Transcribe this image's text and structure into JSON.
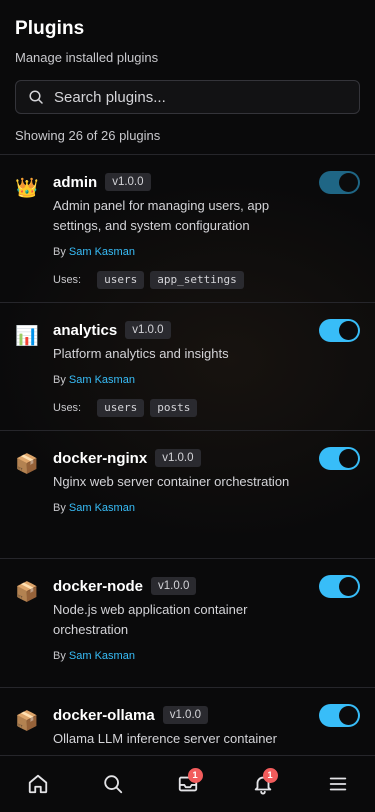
{
  "header": {
    "title": "Plugins",
    "subtitle": "Manage installed plugins"
  },
  "search": {
    "placeholder": "Search plugins...",
    "value": ""
  },
  "count_text": "Showing 26 of 26 plugins",
  "plugins": [
    {
      "icon": "crown-icon",
      "emoji": "👑",
      "name": "admin",
      "version": "v1.0.0",
      "description": "Admin panel for managing users, app settings, and system configuration",
      "author_prefix": "By",
      "author": "Sam Kasman",
      "uses_label": "Uses:",
      "uses": [
        "users",
        "app_settings"
      ],
      "enabled": true,
      "toggle_state": "dimmed"
    },
    {
      "icon": "bar-chart-icon",
      "emoji": "📊",
      "name": "analytics",
      "version": "v1.0.0",
      "description": "Platform analytics and insights",
      "author_prefix": "By",
      "author": "Sam Kasman",
      "uses_label": "Uses:",
      "uses": [
        "users",
        "posts"
      ],
      "enabled": true
    },
    {
      "icon": "package-icon",
      "emoji": "📦",
      "name": "docker-nginx",
      "version": "v1.0.0",
      "description": "Nginx web server container orchestration",
      "author_prefix": "By",
      "author": "Sam Kasman",
      "enabled": true
    },
    {
      "icon": "package-icon",
      "emoji": "📦",
      "name": "docker-node",
      "version": "v1.0.0",
      "description": "Node.js web application container orchestration",
      "author_prefix": "By",
      "author": "Sam Kasman",
      "enabled": true
    },
    {
      "icon": "package-icon",
      "emoji": "📦",
      "name": "docker-ollama",
      "version": "v1.0.0",
      "description": "Ollama LLM inference server container",
      "enabled": true
    }
  ],
  "tabbar": {
    "items": [
      "home-icon",
      "search-icon",
      "inbox-icon",
      "bell-icon",
      "menu-icon"
    ],
    "inbox_badge": "1",
    "bell_badge": "1"
  },
  "colors": {
    "accent": "#38bdf8",
    "accent_dim": "#1f6685",
    "badge": "#f25c5c",
    "background": "#0a0a0b"
  }
}
